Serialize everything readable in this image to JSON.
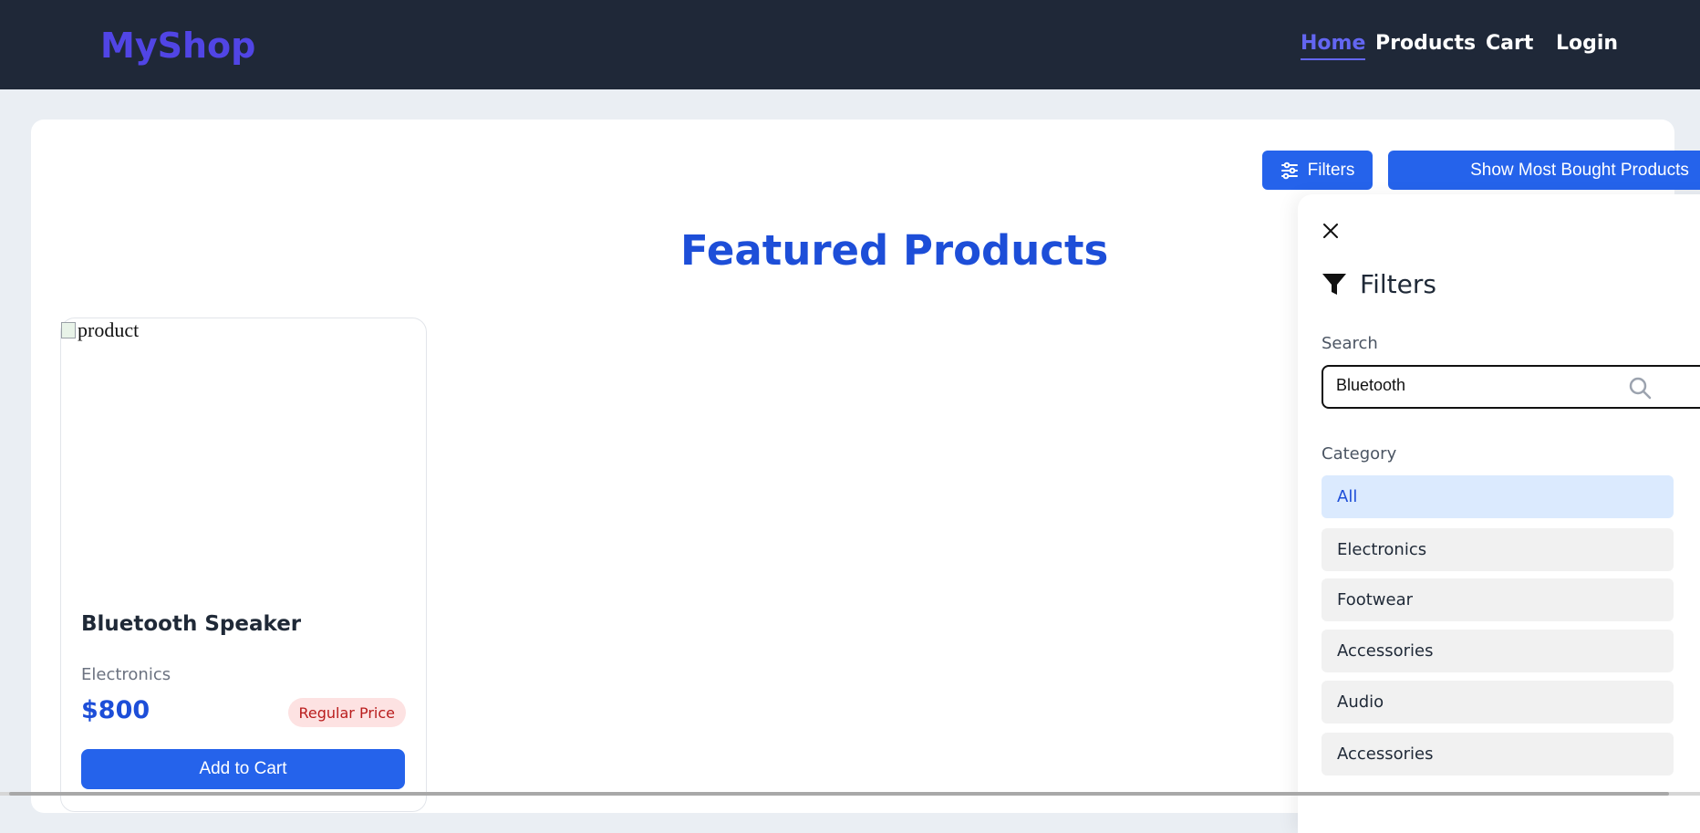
{
  "header": {
    "brand": "MyShop",
    "nav": [
      "Home",
      "Products",
      "Cart",
      "Login"
    ],
    "active_nav": "Home"
  },
  "toolbar": {
    "filters_label": "Filters",
    "most_bought_label": "Show Most Bought Products"
  },
  "main": {
    "title": "Featured Products"
  },
  "products": [
    {
      "image_alt": "product",
      "name": "Bluetooth Speaker",
      "category": "Electronics",
      "price": "$800",
      "badge": "Regular Price",
      "add_label": "Add to Cart"
    }
  ],
  "filter_panel": {
    "title": "Filters",
    "search_label": "Search",
    "search_value": "Bluetooth",
    "category_label": "Category",
    "categories": [
      "All",
      "Electronics",
      "Footwear",
      "Accessories",
      "Audio",
      "Accessories"
    ],
    "selected_category": "All"
  },
  "colors": {
    "header_bg": "#1f2838",
    "brand": "#5145e5",
    "primary": "#2563eb",
    "title": "#1d4ed8",
    "badge_bg": "#fde2e2",
    "badge_text": "#b91c1c"
  },
  "icons": {
    "filters_button": "sliders-icon",
    "panel_close": "close-icon",
    "panel_title": "funnel-icon",
    "search": "search-icon"
  }
}
